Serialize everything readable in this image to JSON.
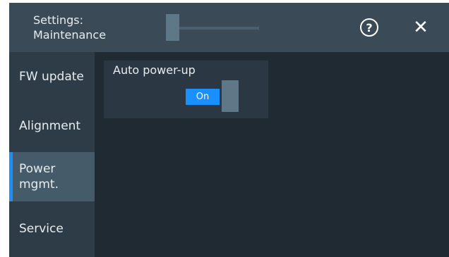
{
  "header": {
    "title": "Settings:\nMaintenance",
    "help_icon": "help-circle-icon",
    "help_glyph": "?",
    "close_icon": "close-icon",
    "close_glyph": "✕"
  },
  "sidebar": {
    "items": [
      {
        "label": "FW update",
        "active": false
      },
      {
        "label": "Alignment",
        "active": false
      },
      {
        "label": "Power\nmgmt.",
        "active": true
      },
      {
        "label": "Service",
        "active": false
      }
    ]
  },
  "main": {
    "auto_power_up": {
      "label": "Auto power-up",
      "toggle_value": "On"
    }
  },
  "colors": {
    "accent": "#1a8fff",
    "header_bg": "#3a4a57",
    "sidebar_bg": "#2e3c47",
    "content_bg": "#1f2a33"
  }
}
